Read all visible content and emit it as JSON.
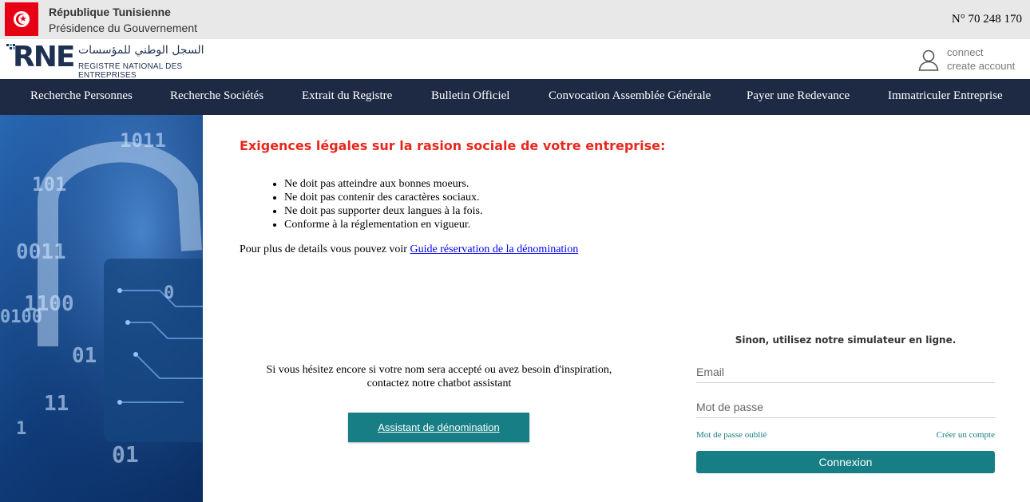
{
  "topbar": {
    "country": "République Tunisienne",
    "presidency": "Présidence du Gouvernement",
    "phone": "N° 70 248 170"
  },
  "logo": {
    "letters": "RNE",
    "arabic": "السجل الوطني للمؤسسات",
    "french": "REGISTRE NATIONAL DES ENTREPRISES"
  },
  "account": {
    "connect_label": "connect",
    "create_label": "create account"
  },
  "nav": {
    "items": [
      {
        "label": "Recherche Personnes"
      },
      {
        "label": "Recherche Sociétés"
      },
      {
        "label": "Extrait du Registre"
      },
      {
        "label": "Bulletin Officiel"
      },
      {
        "label": "Convocation Assemblée Générale"
      },
      {
        "label": "Payer une Redevance"
      },
      {
        "label": "Immatriculer Entreprise"
      }
    ]
  },
  "side": {
    "binary": [
      "101",
      "1011",
      "0011",
      "1100",
      "0100",
      "01",
      "11",
      "1",
      "01",
      "0"
    ]
  },
  "requirements": {
    "title": "Exigences légales sur la rasion sociale de votre entreprise:",
    "items": [
      "Ne doit pas atteindre aux bonnes moeurs.",
      "Ne doit pas contenir des caractères sociaux.",
      "Ne doit pas supporter deux langues à la fois.",
      "Conforme à la réglementation en vigueur."
    ],
    "more_prefix": "Pour plus de details vous pouvez voir ",
    "more_link": "Guide réservation de la dénomination"
  },
  "chatbot": {
    "line1": "Si vous hésitez encore si votre nom sera accepté ou avez besoin d'inspiration,",
    "line2": "contactez notre chatbot assistant",
    "button": "Assistant de dénomination"
  },
  "login": {
    "intro": "Sinon, utilisez notre simulateur en ligne.",
    "email_placeholder": "Email",
    "password_placeholder": "Mot de passe",
    "forgot": "Mot de passe oublié",
    "create": "Créer un compte",
    "submit": "Connexion"
  },
  "colors": {
    "nav_bg": "#1e2a44",
    "accent_teal": "#167e84",
    "title_red": "#e8281e",
    "flag_red": "#e70013"
  }
}
